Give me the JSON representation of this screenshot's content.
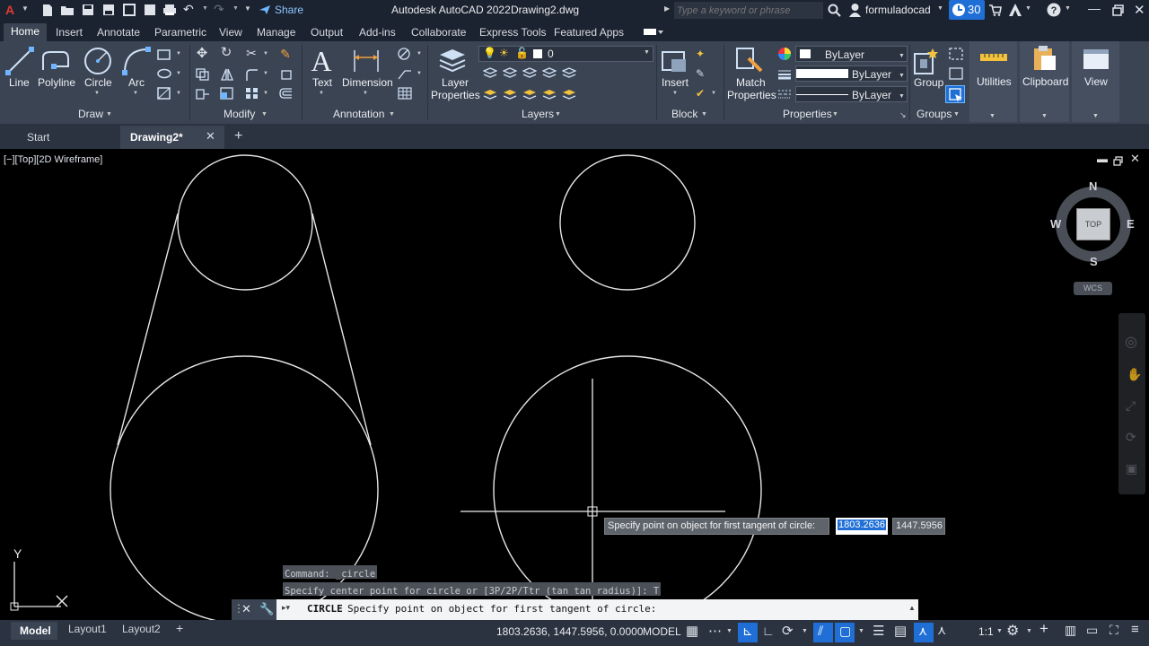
{
  "title_bar": {
    "app_letter": "A",
    "share_label": "Share",
    "window_title": "Autodesk AutoCAD 2022",
    "file_name": "Drawing2.dwg",
    "search_placeholder": "Type a keyword or phrase",
    "username": "formuladocad",
    "trial_days": "30"
  },
  "ribbon_tabs": [
    "Home",
    "Insert",
    "Annotate",
    "Parametric",
    "View",
    "Manage",
    "Output",
    "Add-ins",
    "Collaborate",
    "Express Tools",
    "Featured Apps"
  ],
  "ribbon": {
    "draw": {
      "line": "Line",
      "polyline": "Polyline",
      "circle": "Circle",
      "arc": "Arc",
      "group": "Draw"
    },
    "modify": {
      "group": "Modify"
    },
    "annotation": {
      "text": "Text",
      "dimension": "Dimension",
      "group": "Annotation"
    },
    "layers": {
      "layer_properties_1": "Layer",
      "layer_properties_2": "Properties",
      "current_layer": "0",
      "group": "Layers"
    },
    "block": {
      "insert": "Insert",
      "group": "Block"
    },
    "properties": {
      "match_1": "Match",
      "match_2": "Properties",
      "color": "ByLayer",
      "linetype": "ByLayer",
      "lineweight": "ByLayer",
      "group": "Properties"
    },
    "groups": {
      "group_btn": "Group",
      "group": "Groups"
    },
    "utilities": "Utilities",
    "clipboard": "Clipboard",
    "view": "View"
  },
  "doc_tabs": {
    "start": "Start",
    "current": "Drawing2*"
  },
  "viewport": {
    "label": "[−][Top][2D Wireframe]",
    "viewcube_top": "TOP",
    "compass": {
      "n": "N",
      "s": "S",
      "e": "E",
      "w": "W"
    },
    "wcs": "WCS",
    "ucs_y": "Y"
  },
  "tooltip": {
    "prompt": "Specify point on object for first tangent of circle:",
    "x_value": "1803.2636",
    "y_value": "1447.5956"
  },
  "command_history": [
    "Command: _circle",
    "Specify center point for circle or [3P/2P/Ttr (tan tan radius)]: T"
  ],
  "command_line": {
    "command": "CIRCLE",
    "prompt": "Specify point on object for first tangent of circle:"
  },
  "status_bar": {
    "tabs": [
      "Model",
      "Layout1",
      "Layout2"
    ],
    "coords": "1803.2636, 1447.5956, 0.0000",
    "mode": "MODEL",
    "scale": "1:1"
  },
  "colors": {
    "accent": "#1f6fd6",
    "ribbon": "#3b4453",
    "titlebar": "#1c2330",
    "drawing": "#e6e6e6"
  }
}
